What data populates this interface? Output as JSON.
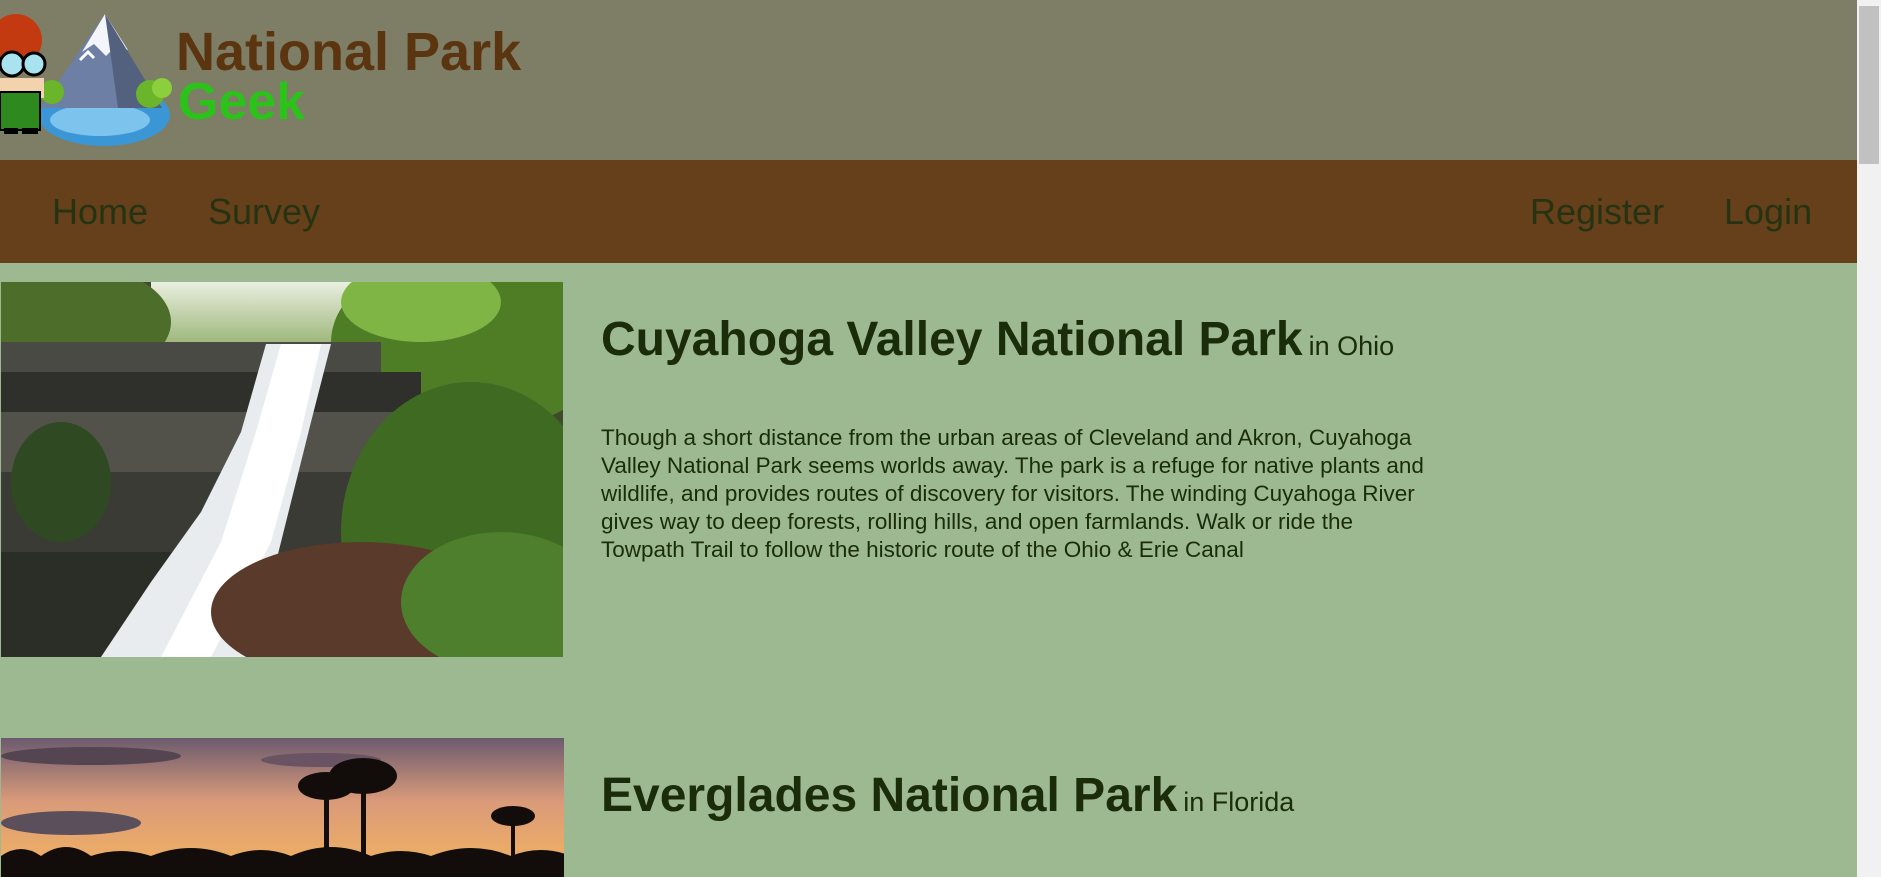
{
  "header": {
    "logo_title": "National Park",
    "logo_subtitle": "Geek",
    "logo_icon": "park-ranger-mountain-logo"
  },
  "nav": {
    "home": "Home",
    "survey": "Survey",
    "register": "Register",
    "login": "Login"
  },
  "parks": [
    {
      "name": "Cuyahoga Valley National Park",
      "state": "in Ohio",
      "description": "Though a short distance from the urban areas of Cleveland and Akron, Cuyahoga Valley National Park seems worlds away. The park is a refuge for native plants and wildlife, and provides routes of discovery for visitors. The winding Cuyahoga River gives way to deep forests, rolling hills, and open farmlands. Walk or ride the Towpath Trail to follow the historic route of the Ohio & Erie Canal",
      "photo": "waterfall-photo"
    },
    {
      "name": "Everglades National Park",
      "state": "in Florida",
      "photo": "sunset-palm-trees-photo"
    }
  ],
  "colors": {
    "header_bg": "#7e7d66",
    "nav_bg": "#66401b",
    "page_bg": "#9db992",
    "logo_title": "#5b3410",
    "logo_subtitle": "#2bc21a",
    "text": "#1b2c0a"
  }
}
